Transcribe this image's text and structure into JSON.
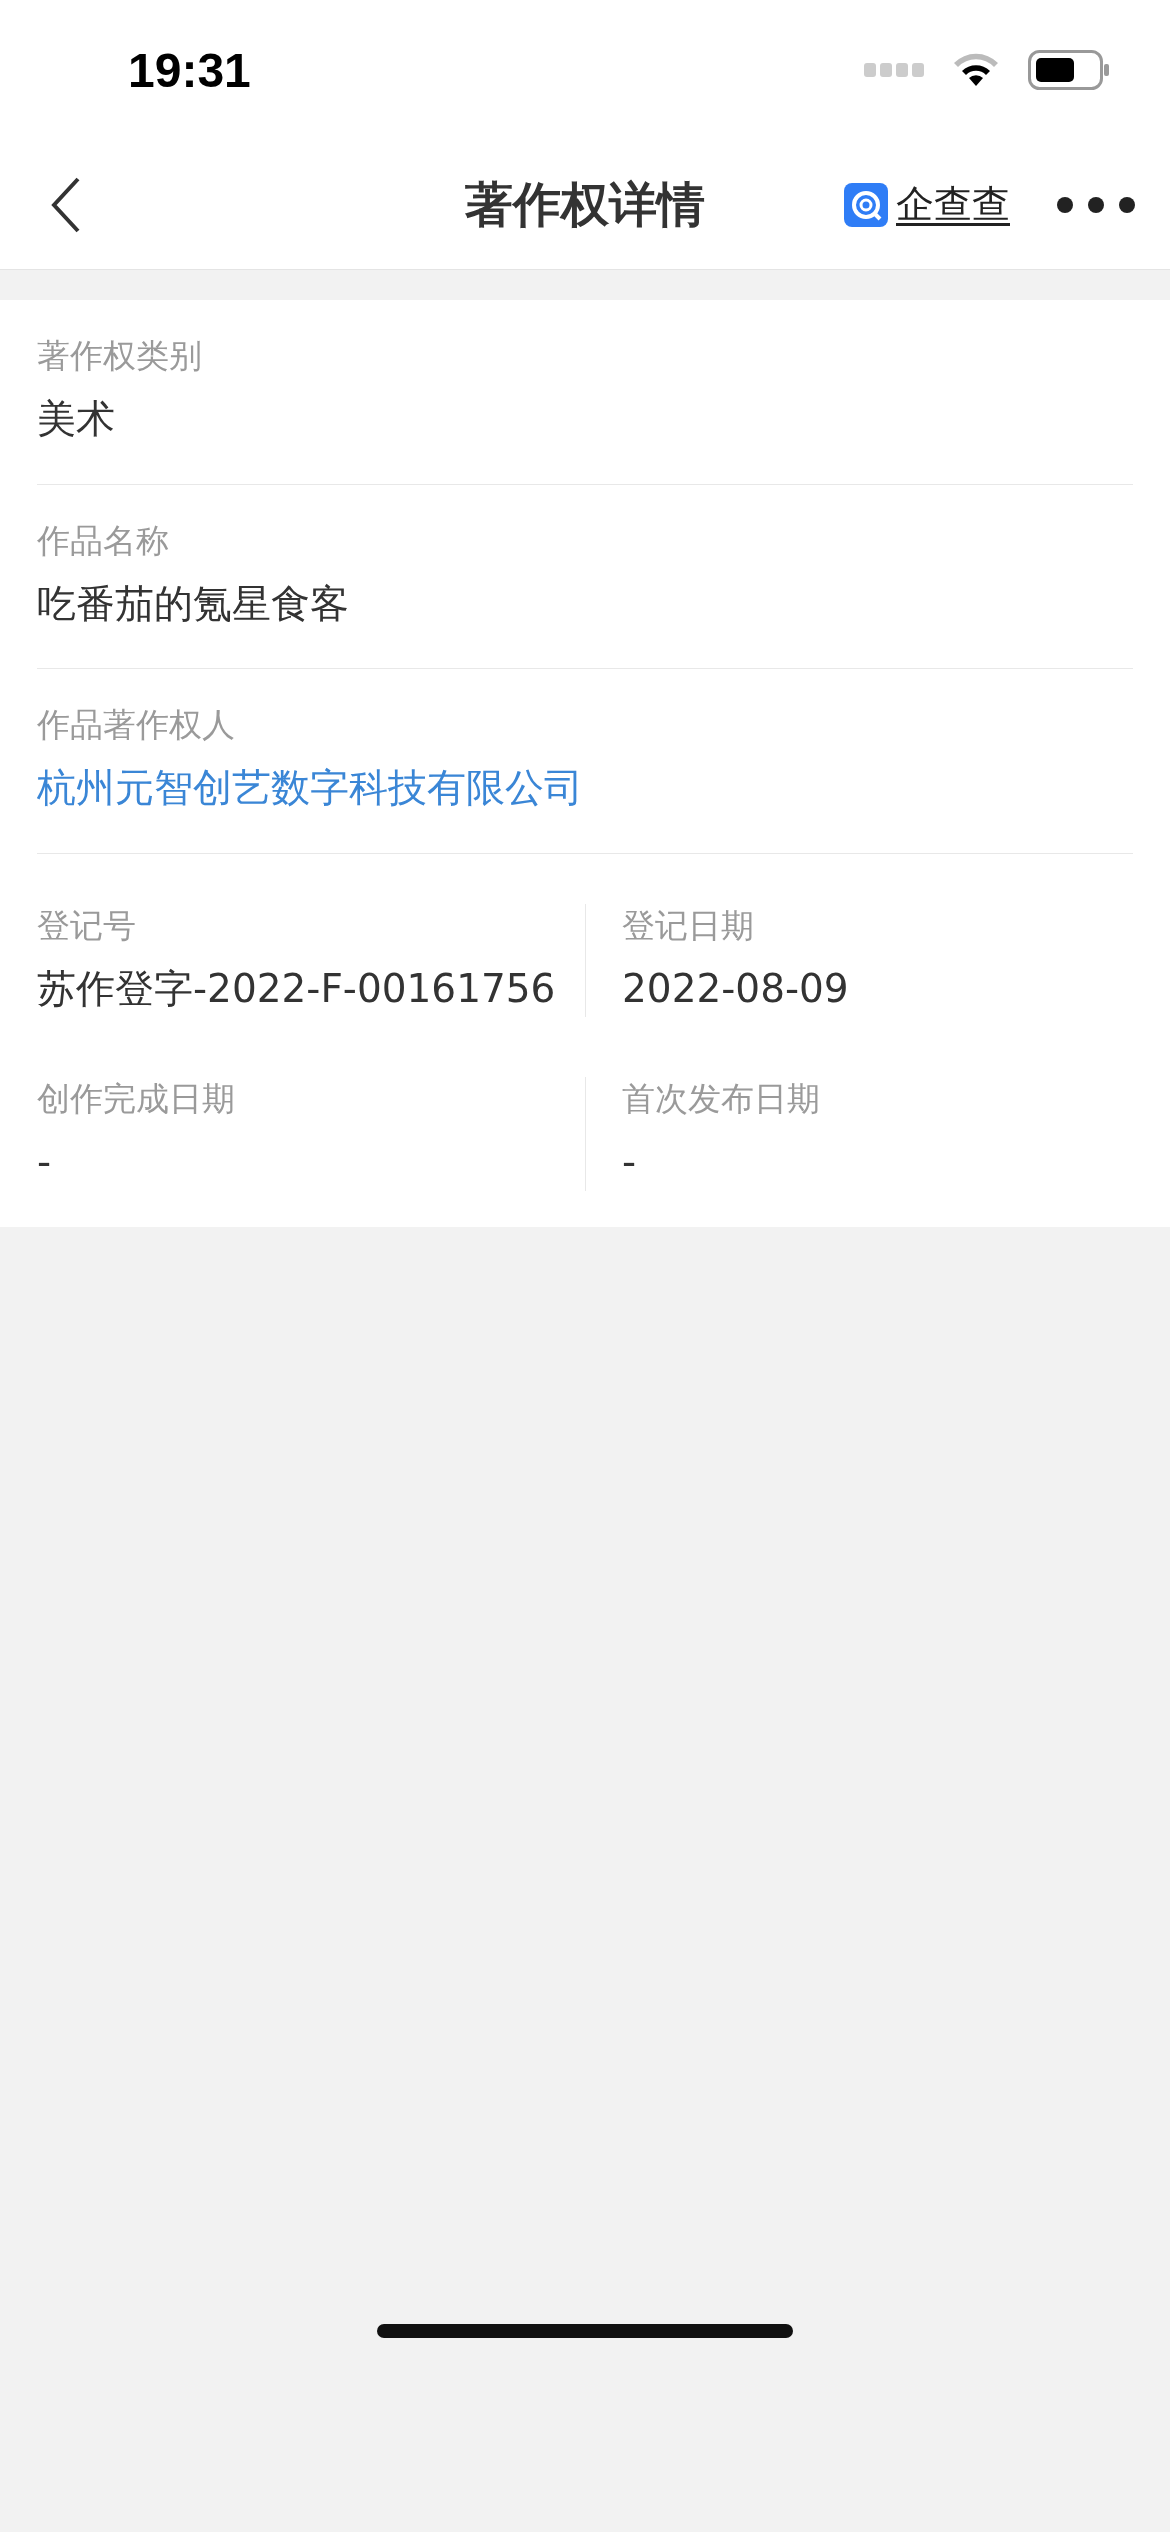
{
  "status_bar": {
    "time": "19:31"
  },
  "nav": {
    "title": "著作权详情",
    "brand": "企查查"
  },
  "fields": [
    {
      "label": "著作权类别",
      "value": "美术",
      "kind": "text"
    },
    {
      "label": "作品名称",
      "value": "吃番茄的氪星食客",
      "kind": "text"
    },
    {
      "label": "作品著作权人",
      "value": "杭州元智创艺数字科技有限公司",
      "kind": "link"
    }
  ],
  "grid_fields": [
    {
      "label": "登记号",
      "value": "苏作登字-2022-F-00161756"
    },
    {
      "label": "登记日期",
      "value": "2022-08-09"
    },
    {
      "label": "创作完成日期",
      "value": "-"
    },
    {
      "label": "首次发布日期",
      "value": "-"
    }
  ]
}
